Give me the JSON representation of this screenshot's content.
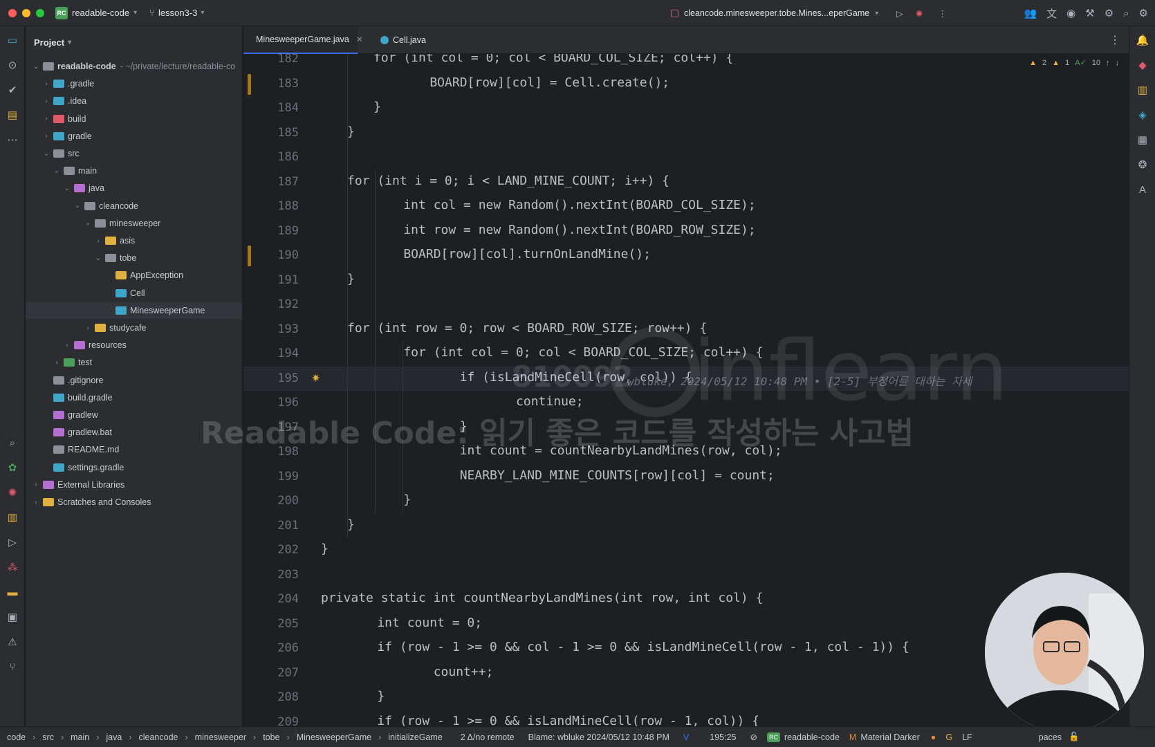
{
  "titlebar": {
    "project_badge": "RC",
    "project_name": "readable-code",
    "branch": "lesson3-3",
    "run_config": "cleancode.minesweeper.tobe.Mines...eperGame"
  },
  "project_panel": {
    "title": "Project",
    "root_suffix": "- ~/private/lecture/readable-co",
    "items": [
      {
        "label": "readable-code",
        "depth": 0,
        "chev": "v",
        "color": "#8a8f98"
      },
      {
        "label": ".gradle",
        "depth": 1,
        "chev": ">",
        "color": "#3ea6c9"
      },
      {
        "label": ".idea",
        "depth": 1,
        "chev": ">",
        "color": "#3ea6c9"
      },
      {
        "label": "build",
        "depth": 1,
        "chev": ">",
        "color": "#e05a6a"
      },
      {
        "label": "gradle",
        "depth": 1,
        "chev": ">",
        "color": "#3ea6c9"
      },
      {
        "label": "src",
        "depth": 1,
        "chev": "v",
        "color": "#8a8f98"
      },
      {
        "label": "main",
        "depth": 2,
        "chev": "v",
        "color": "#8a8f98"
      },
      {
        "label": "java",
        "depth": 3,
        "chev": "v",
        "color": "#b46fd0"
      },
      {
        "label": "cleancode",
        "depth": 4,
        "chev": "v",
        "color": "#8a8f98"
      },
      {
        "label": "minesweeper",
        "depth": 5,
        "chev": "v",
        "color": "#8a8f98"
      },
      {
        "label": "asis",
        "depth": 6,
        "chev": ">",
        "color": "#e0b040"
      },
      {
        "label": "tobe",
        "depth": 6,
        "chev": "v",
        "color": "#8a8f98"
      },
      {
        "label": "AppException",
        "depth": 7,
        "chev": "",
        "color": "#e0b040"
      },
      {
        "label": "Cell",
        "depth": 7,
        "chev": "",
        "color": "#3ea6c9"
      },
      {
        "label": "MinesweeperGame",
        "depth": 7,
        "chev": "",
        "color": "#3ea6c9"
      },
      {
        "label": "studycafe",
        "depth": 5,
        "chev": ">",
        "color": "#e0b040"
      },
      {
        "label": "resources",
        "depth": 3,
        "chev": ">",
        "color": "#b46fd0"
      },
      {
        "label": "test",
        "depth": 2,
        "chev": ">",
        "color": "#4aa05a"
      },
      {
        "label": ".gitignore",
        "depth": 1,
        "chev": "",
        "color": "#8a8f98"
      },
      {
        "label": "build.gradle",
        "depth": 1,
        "chev": "",
        "color": "#3ea6c9"
      },
      {
        "label": "gradlew",
        "depth": 1,
        "chev": "",
        "color": "#b46fd0"
      },
      {
        "label": "gradlew.bat",
        "depth": 1,
        "chev": "",
        "color": "#b46fd0"
      },
      {
        "label": "README.md",
        "depth": 1,
        "chev": "",
        "color": "#8a8f98"
      },
      {
        "label": "settings.gradle",
        "depth": 1,
        "chev": "",
        "color": "#3ea6c9"
      },
      {
        "label": "External Libraries",
        "depth": 0,
        "chev": ">",
        "color": "#b46fd0"
      },
      {
        "label": "Scratches and Consoles",
        "depth": 0,
        "chev": ">",
        "color": "#e0b040"
      }
    ]
  },
  "tabs": [
    {
      "label": "MinesweeperGame.java",
      "active": true
    },
    {
      "label": "Cell.java",
      "active": false
    }
  ],
  "inspections": {
    "warnings_a": "2",
    "warnings_b": "1",
    "typos": "10"
  },
  "editor": {
    "line_numbers": [
      "182",
      "183",
      "184",
      "185",
      "186",
      "187",
      "188",
      "189",
      "190",
      "191",
      "192",
      "193",
      "194",
      "195",
      "196",
      "197",
      "198",
      "199",
      "200",
      "201",
      "202",
      "203",
      "204",
      "205",
      "206",
      "207",
      "208",
      "209"
    ],
    "lines": [
      "for (int col = 0; col < BOARD_COL_SIZE; col++) {",
      "    BOARD[row][col] = Cell.create();",
      "}",
      "}",
      "",
      "for (int i = 0; i < LAND_MINE_COUNT; i++) {",
      "    int col = new Random().nextInt(BOARD_COL_SIZE);",
      "    int row = new Random().nextInt(BOARD_ROW_SIZE);",
      "    BOARD[row][col].turnOnLandMine();",
      "}",
      "",
      "for (int row = 0; row < BOARD_ROW_SIZE; row++) {",
      "    for (int col = 0; col < BOARD_COL_SIZE; col++) {",
      "        if (isLandMineCell(row, col)) {",
      "            continue;",
      "        }",
      "        int count = countNearbyLandMines(row, col);",
      "        NEARBY_LAND_MINE_COUNTS[row][col] = count;",
      "    }",
      "}",
      "}",
      "",
      "private static int countNearbyLandMines(int row, int col) {",
      "    int count = 0;",
      "    if (row - 1 >= 0 && col - 1 >= 0 && isLandMineCell(row - 1, col - 1)) {",
      "        count++;",
      "    }",
      "    if (row - 1 >= 0 && isLandMineCell(row - 1, col)) {"
    ],
    "blame": "wbluke, 2024/05/12 10:48 PM • [2-5] 부정어를 대하는 자세"
  },
  "watermark": {
    "title": "Readable Code: 읽기 좋은 코드를 작성하는 사고법",
    "id": "810092",
    "logo": "inflearn"
  },
  "statusbar": {
    "crumbs": [
      "code",
      "src",
      "main",
      "java",
      "cleancode",
      "minesweeper",
      "tobe",
      "MinesweeperGame",
      "initializeGame"
    ],
    "vcs": "2 Δ/no remote",
    "blame": "Blame: wbluke 2024/05/12 10:48 PM",
    "position": "195:25",
    "project": "readable-code",
    "theme": "Material Darker",
    "line_sep": "LF",
    "indent": "paces"
  }
}
